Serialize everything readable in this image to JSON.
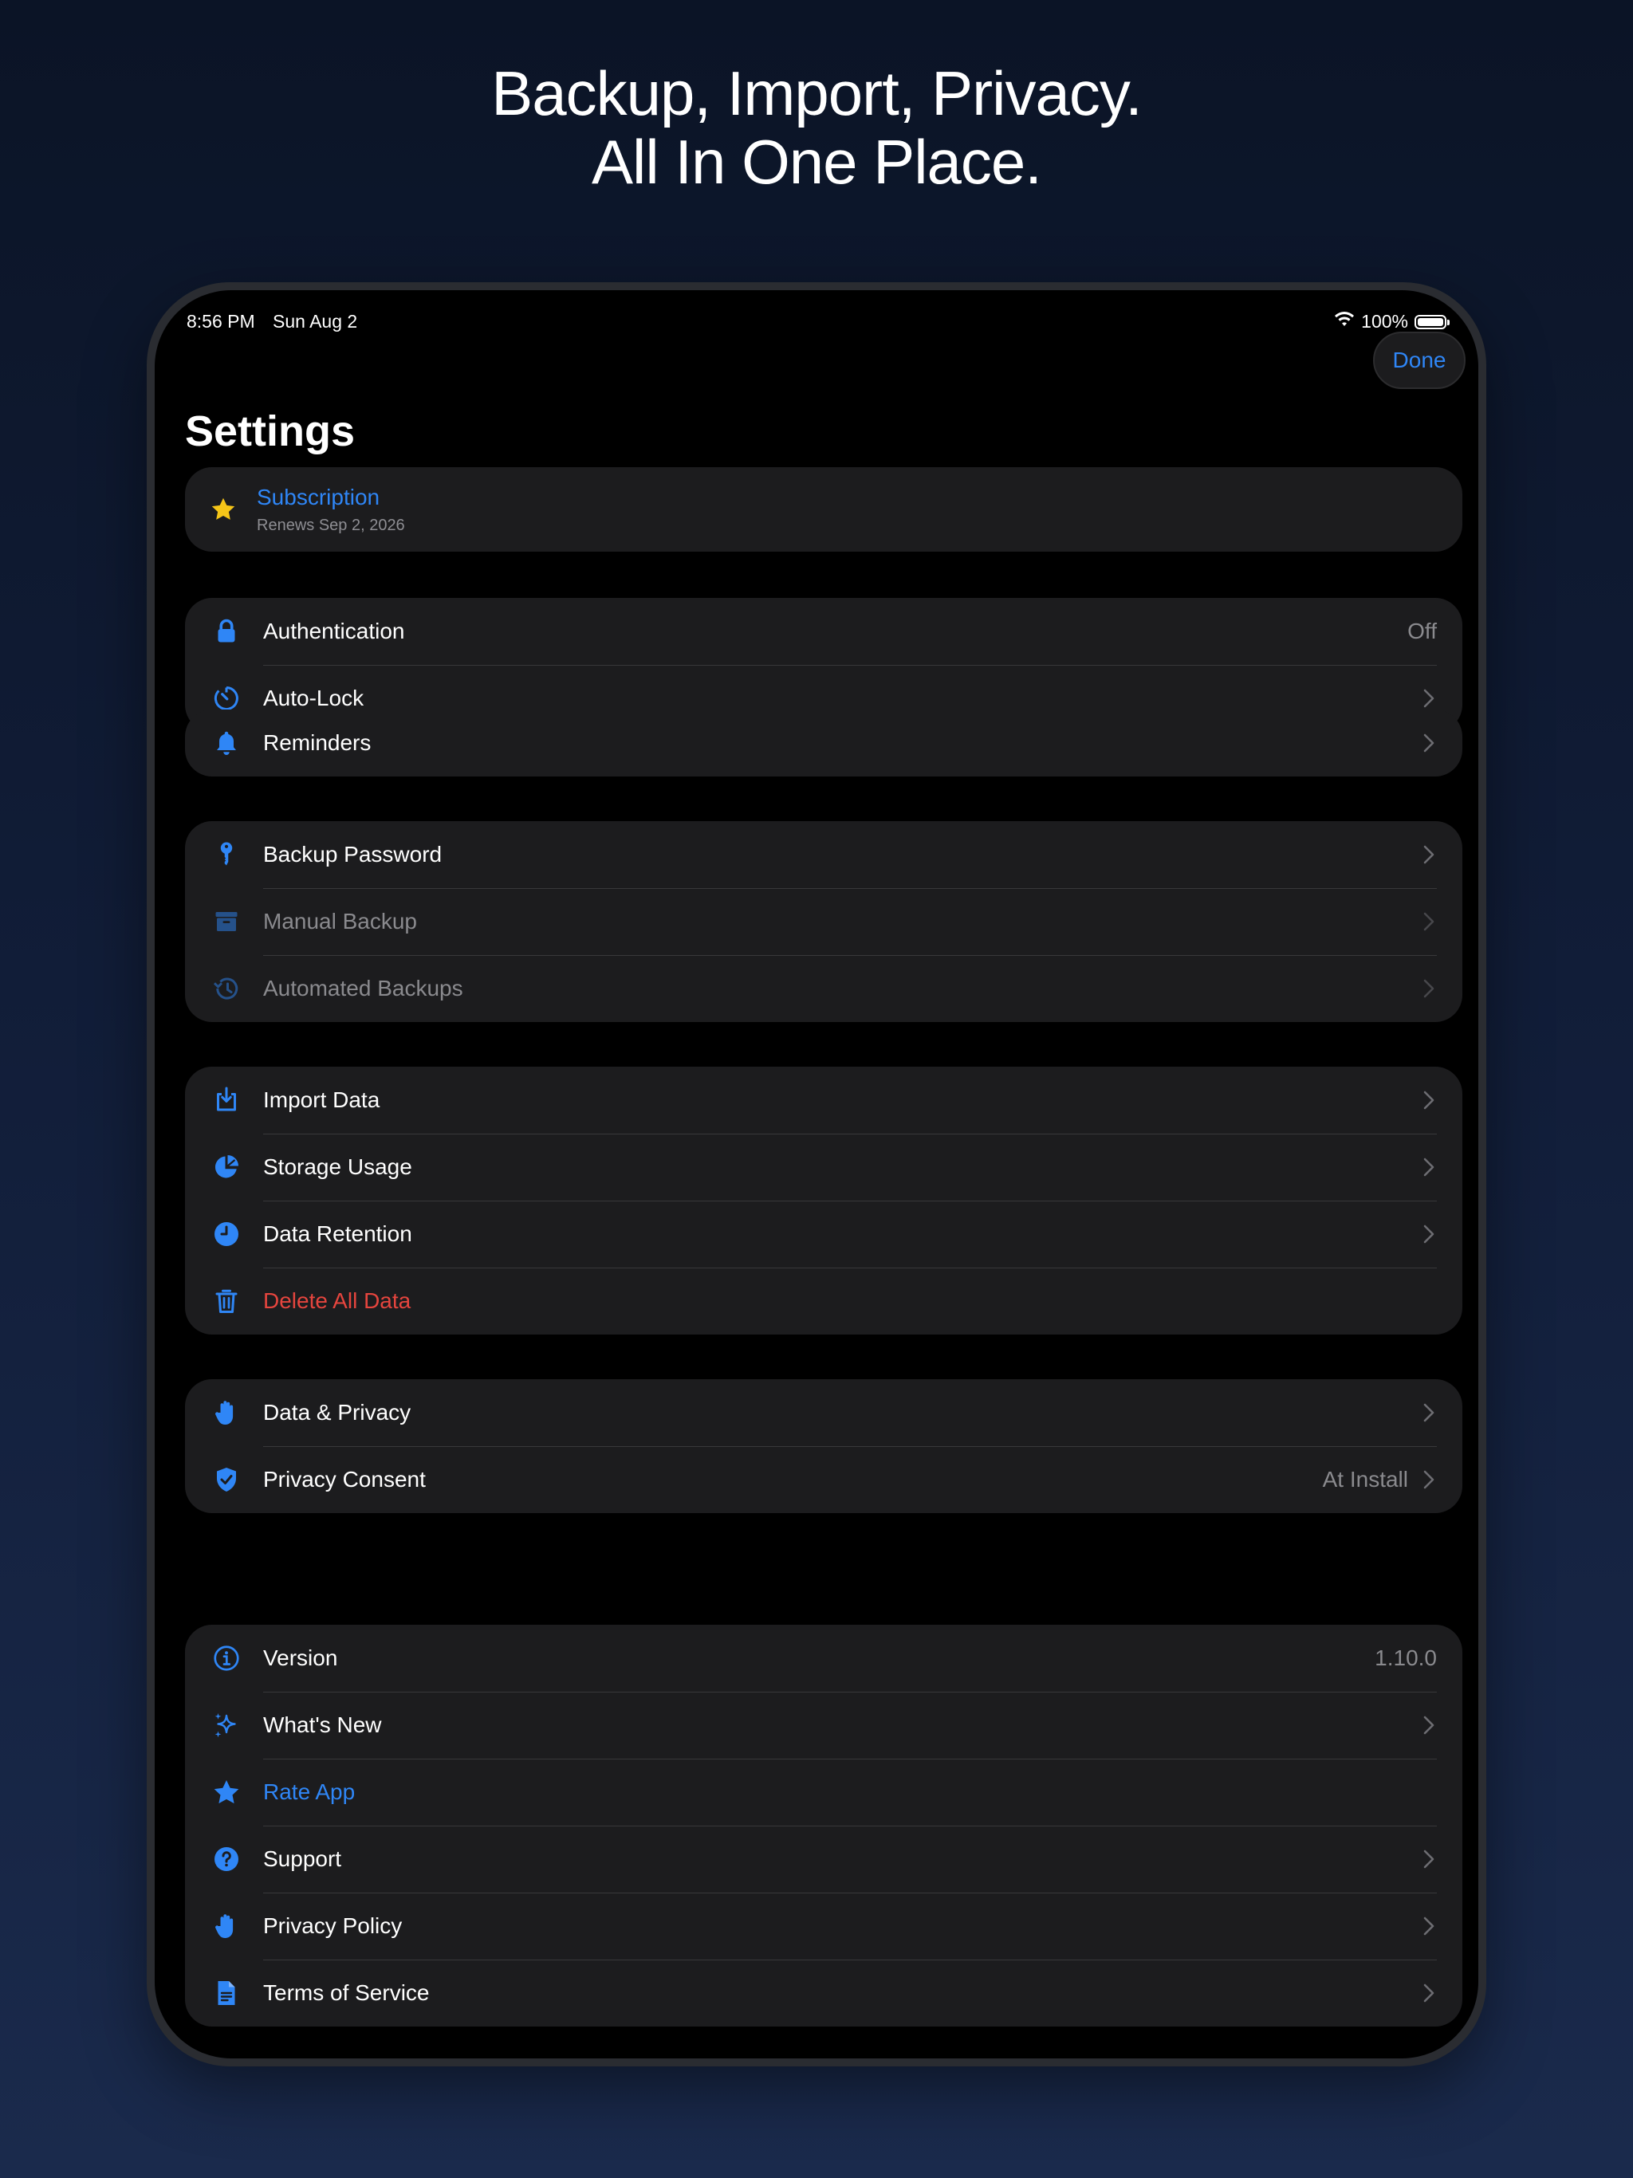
{
  "headline": {
    "line1": "Backup, Import, Privacy.",
    "line2": "All In One Place."
  },
  "status_bar": {
    "time": "8:56 PM",
    "date": "Sun Aug 2",
    "battery": "100%"
  },
  "nav": {
    "done_label": "Done",
    "title": "Settings"
  },
  "subscription": {
    "title": "Subscription",
    "subtitle": "Renews Sep 2, 2026",
    "icon": "star-icon"
  },
  "security": [
    {
      "label": "Authentication",
      "value": "Off",
      "icon": "lock-icon"
    },
    {
      "label": "Auto-Lock",
      "icon": "timer-icon"
    }
  ],
  "notifications": [
    {
      "label": "Reminders",
      "icon": "bell-icon"
    }
  ],
  "backup": [
    {
      "label": "Backup Password",
      "icon": "key-icon"
    },
    {
      "label": "Manual Backup",
      "icon": "archive-box-icon"
    },
    {
      "label": "Automated Backups",
      "icon": "clock-history-icon"
    }
  ],
  "data": [
    {
      "label": "Import Data",
      "icon": "tray-import-icon"
    },
    {
      "label": "Storage Usage",
      "icon": "pie-chart-icon"
    },
    {
      "label": "Data Retention",
      "icon": "clock-icon"
    },
    {
      "label": "Delete All Data",
      "icon": "trash-icon"
    }
  ],
  "privacy": [
    {
      "label": "Data & Privacy",
      "icon": "hand-icon"
    },
    {
      "label": "Privacy Consent",
      "value": "At Install",
      "icon": "shield-check-icon"
    }
  ],
  "about": [
    {
      "label": "Version",
      "value": "1.10.0",
      "icon": "info-icon"
    },
    {
      "label": "What's New",
      "icon": "sparkles-icon"
    },
    {
      "label": "Rate App",
      "icon": "star-icon"
    },
    {
      "label": "Support",
      "icon": "question-icon"
    },
    {
      "label": "Privacy Policy",
      "icon": "hand-icon"
    },
    {
      "label": "Terms of Service",
      "icon": "document-icon"
    }
  ],
  "colors": {
    "accent": "#2f86f6",
    "destructive": "#e5453e",
    "secondary_text": "#8a8a8e",
    "group_bg": "#1c1c1e",
    "star": "#f5c518"
  }
}
